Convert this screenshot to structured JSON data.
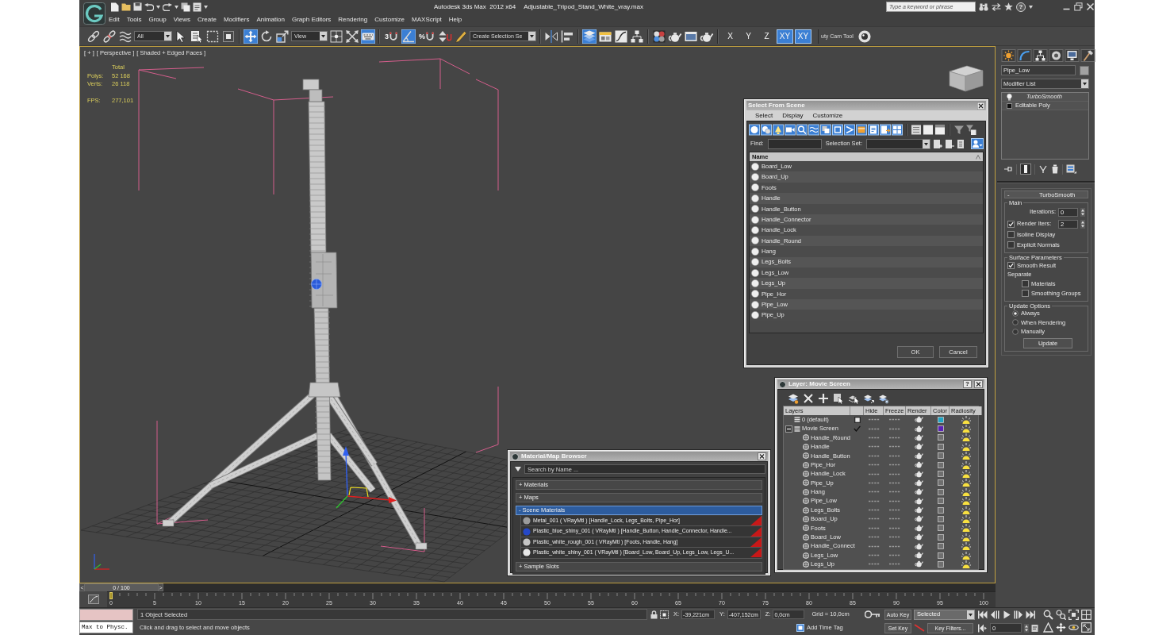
{
  "window": {
    "app_title": "Autodesk 3ds Max  2012 x64",
    "file_name": "Adjustable_Tripod_Stand_White_vray.max",
    "search": {
      "placeholder": "Type a keyword or phrase"
    },
    "help": "?"
  },
  "menu": [
    "Edit",
    "Tools",
    "Group",
    "Views",
    "Create",
    "Modifiers",
    "Animation",
    "Graph Editors",
    "Rendering",
    "Customize",
    "MAXScript",
    "Help"
  ],
  "toolbar": {
    "selection_filter": "All",
    "reference_coord": "View",
    "snap_digit": "3",
    "percent_sign": "%",
    "named_selection": "Create Selection Se",
    "axes": [
      {
        "label": "X",
        "selected": false
      },
      {
        "label": "Y",
        "selected": false
      },
      {
        "label": "Z",
        "selected": false
      },
      {
        "label": "XY",
        "selected": true
      },
      {
        "label": "XY",
        "selected": true
      }
    ],
    "cam_tool": "uty Cam Tool",
    "tools": [
      {
        "on": false
      },
      {
        "on": false
      },
      {
        "on": false
      },
      {
        "on": false
      },
      {
        "on": false
      },
      {
        "on": false
      },
      {
        "on": false
      },
      {
        "on": true
      },
      {
        "on": false
      },
      {
        "on": false
      },
      {
        "on": false
      },
      {
        "on": false
      },
      {
        "on": true
      },
      {
        "on": false
      },
      {
        "on": true
      },
      {
        "on": false
      },
      {
        "on": false
      },
      {
        "on": false
      },
      {
        "on": false
      },
      {
        "on": false
      },
      {
        "on": true
      },
      {
        "on": false
      },
      {
        "on": false
      },
      {
        "on": false
      },
      {
        "on": false
      },
      {
        "on": false
      },
      {
        "on": false
      },
      {
        "on": false
      },
      {
        "on": false
      }
    ]
  },
  "viewport": {
    "labels": [
      "[ + ]",
      "[ Perspective ]",
      "[ Shaded + Edged Faces ]"
    ],
    "stats": {
      "header": "Total",
      "rows": [
        {
          "label": "Polys:",
          "value": "52 168"
        },
        {
          "label": "Verts:",
          "value": "26 118"
        }
      ],
      "fps": {
        "label": "FPS:",
        "value": "277,101"
      }
    }
  },
  "select_dialog": {
    "title": "Select From Scene",
    "menu": [
      "Select",
      "Display",
      "Customize"
    ],
    "filters": [
      {
        "on": true
      },
      {
        "on": true
      },
      {
        "on": true
      },
      {
        "on": true
      },
      {
        "on": true
      },
      {
        "on": true
      },
      {
        "on": true
      },
      {
        "on": true
      },
      {
        "on": true
      },
      {
        "on": true
      },
      {
        "on": true
      },
      {
        "on": true
      },
      {
        "on": true
      }
    ],
    "find_label": "Find:",
    "selection_set_label": "Selection Set:",
    "selection_sync": {
      "on": true
    },
    "column": "Name",
    "objects": [
      {
        "name": "Board_Low",
        "selected": false
      },
      {
        "name": "Board_Up",
        "selected": false
      },
      {
        "name": "Foots",
        "selected": false
      },
      {
        "name": "Handle",
        "selected": false
      },
      {
        "name": "Handle_Button",
        "selected": false
      },
      {
        "name": "Handle_Connector",
        "selected": false
      },
      {
        "name": "Handle_Lock",
        "selected": false
      },
      {
        "name": "Handle_Round",
        "selected": false
      },
      {
        "name": "Hang",
        "selected": false
      },
      {
        "name": "Legs_Bolts",
        "selected": false
      },
      {
        "name": "Legs_Low",
        "selected": false
      },
      {
        "name": "Legs_Up",
        "selected": false
      },
      {
        "name": "Pipe_Hor",
        "selected": false
      },
      {
        "name": "Pipe_Low",
        "selected": false
      },
      {
        "name": "Pipe_Up",
        "selected": false
      }
    ],
    "buttons": [
      "OK",
      "Cancel"
    ]
  },
  "layer_dialog": {
    "title": "Layer: Movie Screen",
    "help": "?",
    "columns": [
      "Layers",
      "Hide",
      "Freeze",
      "Render",
      "Color",
      "Radiosity"
    ],
    "layers": [
      {
        "name": "0 (default)",
        "current": false,
        "color": "#1fa6c6",
        "hidden": false,
        "frozen": false
      },
      {
        "name": "Movie Screen",
        "current": true,
        "expanded": true,
        "color": "#5a22b8",
        "hidden": false,
        "frozen": false,
        "children": [
          {
            "name": "Handle_Round",
            "color": "#6f6f6f",
            "hidden": false,
            "frozen": false
          },
          {
            "name": "Handle",
            "color": "#6f6f6f",
            "hidden": false,
            "frozen": false
          },
          {
            "name": "Handle_Button",
            "color": "#6f6f6f",
            "hidden": false,
            "frozen": false
          },
          {
            "name": "Pipe_Hor",
            "color": "#6f6f6f",
            "hidden": false,
            "frozen": false
          },
          {
            "name": "Handle_Lock",
            "color": "#6f6f6f",
            "hidden": false,
            "frozen": false
          },
          {
            "name": "Pipe_Up",
            "color": "#6f6f6f",
            "hidden": false,
            "frozen": false
          },
          {
            "name": "Hang",
            "color": "#6f6f6f",
            "hidden": false,
            "frozen": false
          },
          {
            "name": "Pipe_Low",
            "color": "#6f6f6f",
            "hidden": false,
            "frozen": false
          },
          {
            "name": "Legs_Bolts",
            "color": "#6f6f6f",
            "hidden": false,
            "frozen": false
          },
          {
            "name": "Board_Up",
            "color": "#6f6f6f",
            "hidden": false,
            "frozen": false
          },
          {
            "name": "Foots",
            "color": "#6f6f6f",
            "hidden": false,
            "frozen": false
          },
          {
            "name": "Board_Low",
            "color": "#6f6f6f",
            "hidden": false,
            "frozen": false
          },
          {
            "name": "Handle_Connect",
            "color": "#6f6f6f",
            "hidden": false,
            "frozen": false
          },
          {
            "name": "Legs_Low",
            "color": "#6f6f6f",
            "hidden": false,
            "frozen": false
          },
          {
            "name": "Legs_Up",
            "color": "#6f6f6f",
            "hidden": false,
            "frozen": false
          }
        ]
      }
    ]
  },
  "material_browser": {
    "title": "Material/Map Browser",
    "search": {
      "placeholder": "Search by Name ..."
    },
    "sections": [
      {
        "toggle": "+",
        "label": "Materials",
        "selected": false
      },
      {
        "toggle": "+",
        "label": "Maps",
        "selected": false
      },
      {
        "toggle": "-",
        "label": "Scene Materials",
        "selected": true,
        "items": [
          {
            "label": "Metal_001 ( VRayMtl ) [Handle_Lock, Legs_Bolts, Pipe_Hor]",
            "color": "#9c9c9c"
          },
          {
            "label": "Plastic_blue_shiny_001 ( VRayMtl ) [Handle_Button, Handle_Connector, Handle...",
            "color": "#2548c8"
          },
          {
            "label": "Plastic_white_rough_001 ( VRayMtl ) [Foots, Handle, Hang]",
            "color": "#c4c4c4"
          },
          {
            "label": "Plastic_white_shiny_001 ( VRayMtl ) [Board_Low, Board_Up, Legs_Low, Legs_U...",
            "color": "#e8e8e8"
          }
        ]
      },
      {
        "toggle": "+",
        "label": "Sample Slots",
        "selected": false
      }
    ]
  },
  "command_panel": {
    "object_name": "Pipe_Low",
    "modifier_list": "Modifier List",
    "stack": [
      {
        "label": "TurboSmooth",
        "kind": "modifier",
        "selected": false
      },
      {
        "label": "Editable Poly",
        "kind": "base",
        "selected": false
      }
    ],
    "show_end_result": true,
    "rollout": {
      "toggle": "-",
      "title": "TurboSmooth",
      "groups": [
        {
          "title": "Main",
          "items": [
            {
              "kind": "spinner",
              "label": "Iterations:",
              "value": "0"
            },
            {
              "kind": "check_spinner",
              "label": "Render Iters:",
              "value": "2",
              "checked": true
            },
            {
              "kind": "checkbox",
              "label": "Isoline Display",
              "checked": false
            },
            {
              "kind": "checkbox",
              "label": "Explicit Normals",
              "checked": false
            }
          ]
        },
        {
          "title": "Surface Parameters",
          "items": [
            {
              "kind": "checkbox",
              "label": "Smooth Result",
              "checked": true
            },
            {
              "kind": "heading",
              "label": "Separate",
              "children": [
                {
                  "kind": "checkbox",
                  "label": "Materials",
                  "checked": false
                },
                {
                  "kind": "checkbox",
                  "label": "Smoothing Groups",
                  "checked": false
                }
              ]
            }
          ]
        },
        {
          "title": "Update Options",
          "items": [
            {
              "kind": "radio",
              "label": "Always",
              "selected": true
            },
            {
              "kind": "radio",
              "label": "When Rendering",
              "selected": false
            },
            {
              "kind": "radio",
              "label": "Manually",
              "selected": false
            },
            {
              "kind": "button",
              "label": "Update"
            }
          ]
        }
      ]
    }
  },
  "timeline": {
    "prev": "<",
    "thumb": "0 / 100",
    "next": ">",
    "level": 0,
    "ruler": [
      "0",
      "5",
      "10",
      "15",
      "20",
      "25",
      "30",
      "35",
      "40",
      "45",
      "50",
      "55",
      "60",
      "65",
      "70",
      "75",
      "80",
      "85",
      "90",
      "95",
      "100"
    ]
  },
  "status": {
    "listener_output": "Max to Physc.",
    "selection_info": "1 Object Selected",
    "prompt": "Click and drag to select and move objects",
    "coords": [
      {
        "label": "X:",
        "value": "-39,221cm"
      },
      {
        "label": "Y:",
        "value": "-407,152cm"
      },
      {
        "label": "Z:",
        "value": "0,0cm"
      }
    ],
    "grid": "Grid = 10,0cm",
    "time_tag": "Add Time Tag",
    "auto_key": {
      "label": "Auto Key",
      "on": false
    },
    "key_mode": "Selected",
    "set_key": "Set Key",
    "key_filters": "Key Filters...",
    "frame": "0"
  }
}
